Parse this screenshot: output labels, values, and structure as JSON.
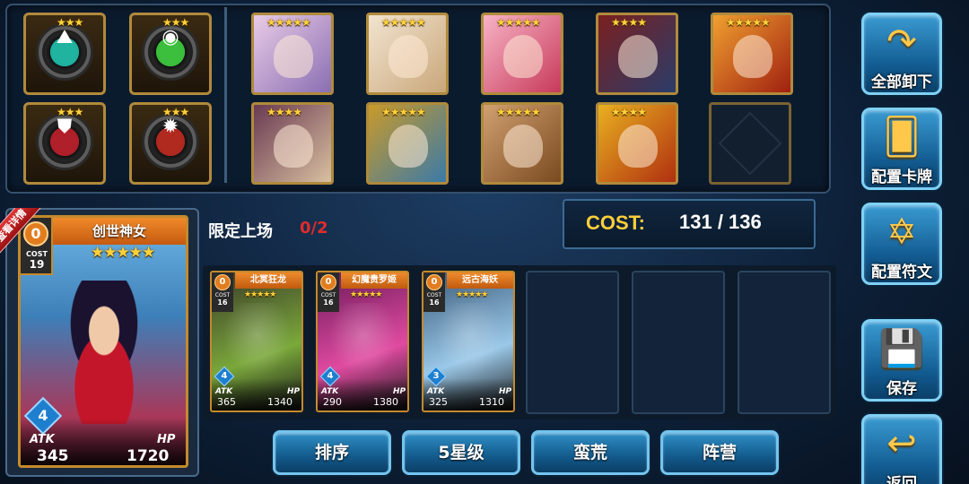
{
  "runes": [
    {
      "name": "teal-rune",
      "stars": "★★★",
      "color": "#1fb3a0",
      "glyph": "⛰"
    },
    {
      "name": "green-rune",
      "stars": "★★★",
      "color": "#3cbf3c",
      "glyph": "◉"
    },
    {
      "name": "red-shield-rune",
      "stars": "★★★",
      "color": "#b0202a",
      "glyph": "⛊"
    },
    {
      "name": "red-orb-rune",
      "stars": "★★★",
      "color": "#b02a20",
      "glyph": "✹"
    }
  ],
  "team_heroes": [
    {
      "stars": "★★★★★",
      "colors": [
        "#e9cbe6",
        "#8a6fb3"
      ]
    },
    {
      "stars": "★★★★★",
      "colors": [
        "#f2e4d0",
        "#c9a77a"
      ]
    },
    {
      "stars": "★★★★★",
      "colors": [
        "#f7b3c6",
        "#c73a5a"
      ]
    },
    {
      "stars": "★★★★",
      "colors": [
        "#7a2020",
        "#2a3c6a"
      ]
    },
    {
      "stars": "★★★★★",
      "colors": [
        "#f0a030",
        "#a02010"
      ]
    },
    {
      "stars": "★★★★",
      "colors": [
        "#6a3a52",
        "#d8c0a0"
      ]
    },
    {
      "stars": "★★★★★",
      "colors": [
        "#c99a2a",
        "#3a7aa8"
      ]
    },
    {
      "stars": "★★★★★",
      "colors": [
        "#d0a070",
        "#7a4a20"
      ]
    },
    {
      "stars": "★★★★",
      "colors": [
        "#e8b020",
        "#b03010"
      ]
    }
  ],
  "cost": {
    "label": "COST:",
    "value": "131  /  136"
  },
  "limit": {
    "label": "限定上场",
    "count": "0/2"
  },
  "featured_card": {
    "ribbon": "查看详情",
    "name": "创世神女",
    "cost": "0",
    "cost_label": "COST",
    "cost_value": "19",
    "stars": "★★★★★",
    "level": "4",
    "atk_label": "ATK",
    "hp_label": "HP",
    "atk": "345",
    "hp": "1720"
  },
  "deck_cards": [
    {
      "name": "北冥狂龙",
      "cost": "0",
      "cost_label": "COST",
      "cost_value": "16",
      "stars": "★★★★★",
      "level": "4",
      "atk": "365",
      "hp": "1340",
      "colors": [
        "#3a3a2a",
        "#7aa83a"
      ]
    },
    {
      "name": "幻魔贵罗姬",
      "cost": "0",
      "cost_label": "COST",
      "cost_value": "16",
      "stars": "★★★★★",
      "level": "4",
      "atk": "290",
      "hp": "1380",
      "colors": [
        "#6a1a5a",
        "#e04aa0"
      ]
    },
    {
      "name": "远古海妖",
      "cost": "0",
      "cost_label": "COST",
      "cost_value": "16",
      "stars": "★★★★★",
      "level": "3",
      "atk": "325",
      "hp": "1310",
      "colors": [
        "#3a5a7a",
        "#9ac8e8"
      ]
    }
  ],
  "card_labels": {
    "atk": "ATK",
    "hp": "HP"
  },
  "filters": [
    "排序",
    "5星级",
    "蛮荒",
    "阵营"
  ],
  "side_buttons": [
    {
      "label": "全部卸下",
      "icon": "↷"
    },
    {
      "label": "配置卡牌",
      "icon": "🂠"
    },
    {
      "label": "配置符文",
      "icon": "✡"
    },
    {
      "label": "保存",
      "icon": "💾"
    },
    {
      "label": "返回",
      "icon": "↩"
    }
  ]
}
